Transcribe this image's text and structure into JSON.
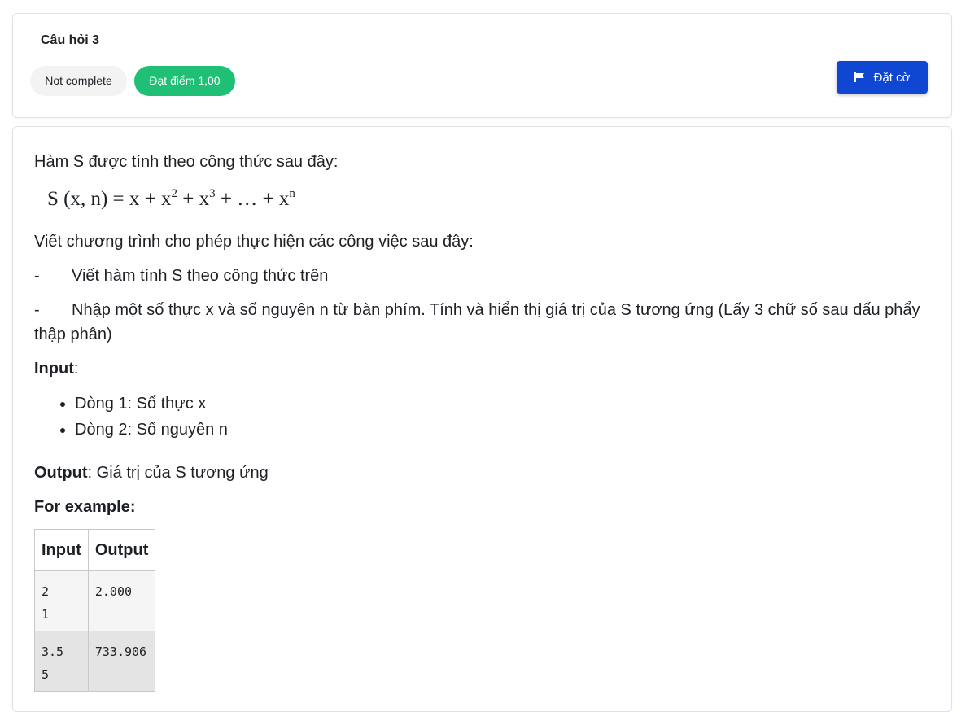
{
  "question": {
    "title": "Câu hỏi 3",
    "status": "Not complete",
    "mark": "Đạt điểm 1,00",
    "flag_label": "Đặt cờ"
  },
  "content": {
    "intro": "Hàm S được tính theo công thức sau đây:",
    "formula": {
      "lhs": "S (x, n) = x + x",
      "exp2": "2",
      "mid1": " + x",
      "exp3": "3",
      "mid2": " + … + x",
      "expn": "n"
    },
    "task_intro": "Viết chương trình cho phép thực hiện các công việc sau đây:",
    "tasks": [
      {
        "dash": "-",
        "text": "Viết hàm tính S theo công thức trên"
      },
      {
        "dash": "-",
        "text": "Nhập một số thực x và số nguyên n từ bàn phím. Tính và hiển thị giá trị của S tương ứng (Lấy 3 chữ số sau dấu phẩy thập phân)"
      }
    ],
    "input_label": "Input",
    "input_colon": ":",
    "input_items": [
      "Dòng 1: Số thực x",
      "Dòng 2: Số nguyên n"
    ],
    "output_label": "Output",
    "output_text": ": Giá trị của S tương ứng",
    "example_label": "For example:"
  },
  "examples_table": {
    "headers": [
      "Input",
      "Output"
    ],
    "rows": [
      {
        "input": "2\n1",
        "output": "2.000"
      },
      {
        "input": "3.5\n5",
        "output": "733.906"
      }
    ]
  },
  "colors": {
    "mark_badge": "#1fbf75",
    "flag_button": "#0f47d3",
    "status_badge": "#f3f3f3"
  },
  "icons": {
    "flag": "flag-icon"
  }
}
